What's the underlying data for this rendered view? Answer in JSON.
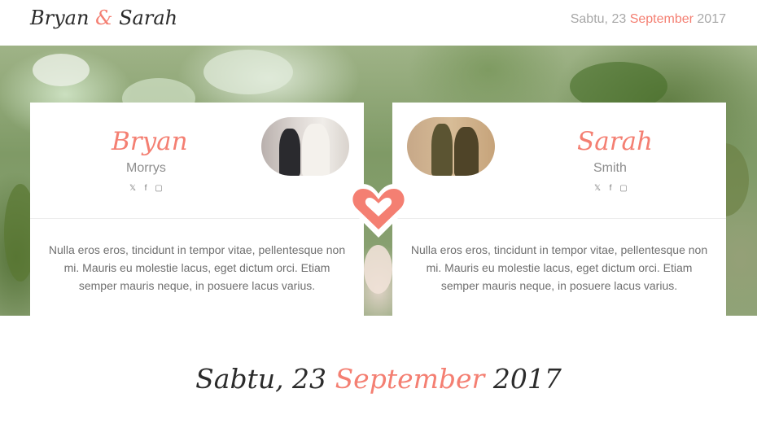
{
  "header": {
    "brand_first": "Bryan",
    "brand_amp": "&",
    "brand_second": "Sarah",
    "date_prefix": "Sabtu, 23",
    "date_month": "September",
    "date_year": "2017"
  },
  "groom": {
    "name": "Bryan",
    "surname": "Morrys",
    "socials": [
      "twitter-icon",
      "facebook-icon",
      "instagram-icon"
    ],
    "bio": "Nulla eros eros, tincidunt in tempor vitae, pellentesque non mi. Mauris eu molestie lacus, eget dictum orci. Etiam semper mauris neque, in posuere lacus varius."
  },
  "bride": {
    "name": "Sarah",
    "surname": "Smith",
    "socials": [
      "twitter-icon",
      "facebook-icon",
      "instagram-icon"
    ],
    "bio": "Nulla eros eros, tincidunt in tempor vitae, pellentesque non mi. Mauris eu molestie lacus, eget dictum orci. Etiam semper mauris neque, in posuere lacus varius."
  },
  "event": {
    "date_prefix": "Sabtu, 23",
    "date_month": "September",
    "date_year": "2017"
  },
  "colors": {
    "accent": "#f47f72",
    "text_dark": "#2b2b2b",
    "text_muted": "#8d8d8d"
  }
}
